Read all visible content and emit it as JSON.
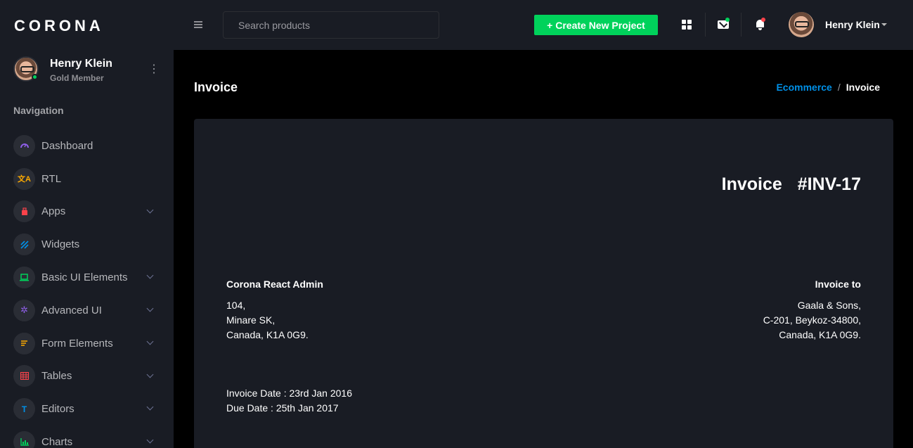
{
  "brand": "CORONA",
  "profile": {
    "name": "Henry Klein",
    "role": "Gold Member"
  },
  "sidebar": {
    "title": "Navigation",
    "items": [
      {
        "label": "Dashboard",
        "icon": "speedometer-icon",
        "color": "#8f5fe8",
        "has_children": false
      },
      {
        "label": "RTL",
        "icon": "translate-icon",
        "color": "#ffab00",
        "has_children": false
      },
      {
        "label": "Apps",
        "icon": "apps-icon",
        "color": "#fc424a",
        "has_children": true
      },
      {
        "label": "Widgets",
        "icon": "widgets-icon",
        "color": "#0090e7",
        "has_children": false
      },
      {
        "label": "Basic UI Elements",
        "icon": "laptop-icon",
        "color": "#00d25b",
        "has_children": true
      },
      {
        "label": "Advanced UI",
        "icon": "settings-icon",
        "color": "#8f5fe8",
        "has_children": true
      },
      {
        "label": "Form Elements",
        "icon": "form-icon",
        "color": "#ffab00",
        "has_children": true
      },
      {
        "label": "Tables",
        "icon": "table-icon",
        "color": "#fc424a",
        "has_children": true
      },
      {
        "label": "Editors",
        "icon": "text-icon",
        "color": "#0090e7",
        "has_children": true
      },
      {
        "label": "Charts",
        "icon": "chart-icon",
        "color": "#00d25b",
        "has_children": true
      }
    ]
  },
  "topbar": {
    "search_placeholder": "Search products",
    "create_button": "+ Create New Project",
    "user_name": "Henry Klein",
    "mail_badge_color": "#00d25b",
    "bell_badge_color": "#fc424a"
  },
  "page": {
    "title": "Invoice",
    "breadcrumb": {
      "parent": "Ecommerce",
      "separator": "/",
      "current": "Invoice"
    }
  },
  "invoice": {
    "title": "Invoice  #INV-17",
    "from": {
      "heading": "Corona React Admin",
      "line1": "104,",
      "line2": "Minare SK,",
      "line3": "Canada, K1A 0G9."
    },
    "to": {
      "heading": "Invoice to",
      "line1": "Gaala & Sons,",
      "line2": "C-201, Beykoz-34800,",
      "line3": "Canada, K1A 0G9."
    },
    "invoice_date": "Invoice Date : 23rd Jan 2016",
    "due_date": "Due Date : 25th Jan 2017"
  },
  "colors": {
    "accent": "#00d25b",
    "link": "#0090e7",
    "sidebar_bg": "#191c24",
    "page_bg": "#000000"
  }
}
